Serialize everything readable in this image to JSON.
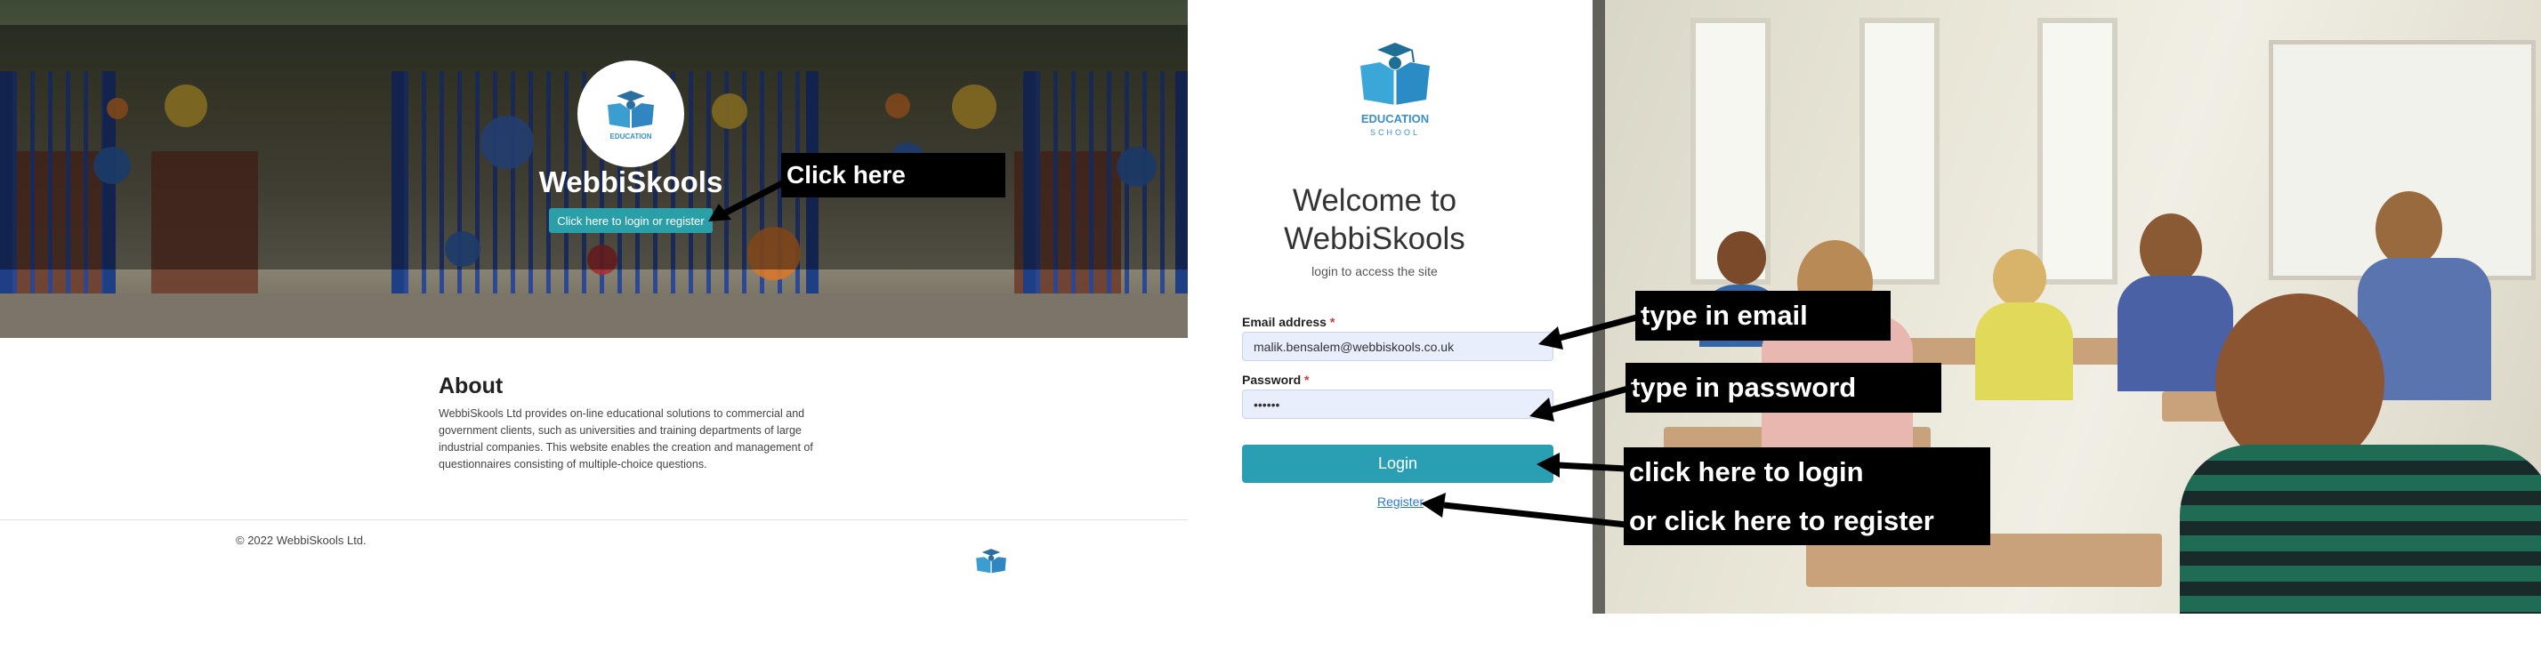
{
  "landing": {
    "logo_text": "EDUCATION",
    "site_title": "WebbiSkools",
    "login_button_label": "Click here to login or register",
    "about_heading": "About",
    "about_text": "WebbiSkools Ltd provides on-line educational solutions to commercial and government clients, such as universities and training departments of large industrial companies. This website enables the creation and management of questionnaires consisting of multiple-choice questions.",
    "footer_copyright": "© 2022 WebbiSkools Ltd."
  },
  "login": {
    "logo_line1": "EDUCATION",
    "logo_line2": "SCHOOL",
    "welcome_title": "Welcome to WebbiSkools",
    "subtitle": "login to access the site",
    "email_label": "Email address",
    "email_value": "malik.bensalem@webbiskools.co.uk",
    "password_label": "Password",
    "password_value": "••••••",
    "required_marker": "*",
    "login_button": "Login",
    "register_link": "Register"
  },
  "annotations": {
    "click_here": "Click here",
    "type_email": "type in email",
    "type_password": "type in password",
    "click_login": "click here to login",
    "click_register": "or click here to register"
  },
  "colors": {
    "accent": "#2a9fb4",
    "callout_bg": "#000000",
    "logo_blue": "#3a8fc9"
  }
}
